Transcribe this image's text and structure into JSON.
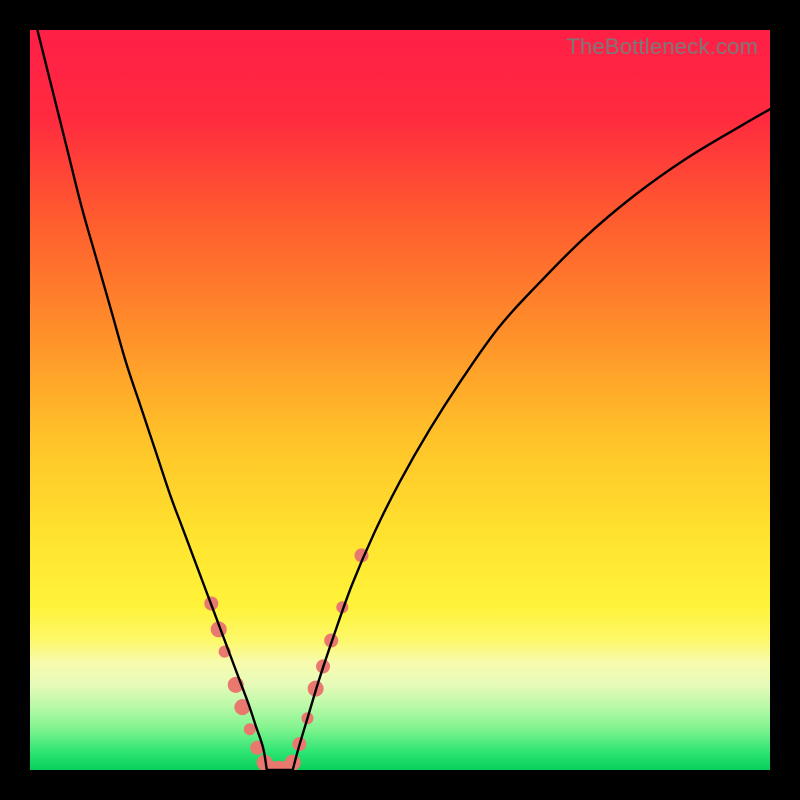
{
  "watermark": "TheBottleneck.com",
  "gradient": {
    "stops": [
      {
        "offset": 0.0,
        "color": "#ff1f46"
      },
      {
        "offset": 0.12,
        "color": "#ff2b3f"
      },
      {
        "offset": 0.25,
        "color": "#ff5a2f"
      },
      {
        "offset": 0.4,
        "color": "#ff8c2a"
      },
      {
        "offset": 0.55,
        "color": "#ffc229"
      },
      {
        "offset": 0.68,
        "color": "#ffe22e"
      },
      {
        "offset": 0.78,
        "color": "#fff33a"
      },
      {
        "offset": 0.825,
        "color": "#fdf86a"
      },
      {
        "offset": 0.855,
        "color": "#f8fbaf"
      },
      {
        "offset": 0.885,
        "color": "#e6fbb8"
      },
      {
        "offset": 0.915,
        "color": "#b7f9a6"
      },
      {
        "offset": 0.945,
        "color": "#7ef38e"
      },
      {
        "offset": 0.975,
        "color": "#2fe573"
      },
      {
        "offset": 1.0,
        "color": "#07cf5b"
      }
    ]
  },
  "chart_data": {
    "type": "line",
    "title": "",
    "xlabel": "",
    "ylabel": "",
    "xlim": [
      0,
      100
    ],
    "ylim": [
      0,
      100
    ],
    "grid": false,
    "legend": false,
    "series": [
      {
        "name": "left-branch",
        "x": [
          1,
          3,
          5,
          7,
          9,
          11,
          13,
          15,
          17,
          19,
          20.5,
          22,
          23.5,
          25,
          26.5,
          28,
          29.5,
          30.5,
          31.5,
          32
        ],
        "y": [
          100,
          92,
          84,
          76,
          69,
          62,
          55,
          49,
          43,
          37,
          33,
          29,
          25,
          21,
          17,
          13,
          9,
          6,
          3,
          0
        ]
      },
      {
        "name": "valley-floor",
        "x": [
          32,
          32.7,
          33.4,
          34.1,
          34.8,
          35.5
        ],
        "y": [
          0,
          0,
          0,
          0,
          0,
          0
        ]
      },
      {
        "name": "right-branch",
        "x": [
          35.5,
          36.3,
          37.5,
          39,
          41,
          43.5,
          46.5,
          50,
          54,
          58.5,
          63.5,
          69,
          75,
          81.5,
          88.5,
          96,
          100
        ],
        "y": [
          0,
          3,
          7,
          12,
          18,
          25,
          32,
          39,
          46,
          53,
          60,
          66,
          72,
          77.5,
          82.5,
          87,
          89.3
        ]
      }
    ],
    "markers": {
      "name": "highlight-dots",
      "color": "#e9786f",
      "points": [
        {
          "x": 24.5,
          "y": 22.5,
          "r": 7
        },
        {
          "x": 25.5,
          "y": 19.0,
          "r": 8
        },
        {
          "x": 26.3,
          "y": 16.0,
          "r": 6
        },
        {
          "x": 27.8,
          "y": 11.5,
          "r": 8
        },
        {
          "x": 28.7,
          "y": 8.5,
          "r": 8
        },
        {
          "x": 29.7,
          "y": 5.5,
          "r": 6
        },
        {
          "x": 30.7,
          "y": 3.0,
          "r": 7
        },
        {
          "x": 31.7,
          "y": 1.0,
          "r": 8
        },
        {
          "x": 32.6,
          "y": 0.3,
          "r": 7
        },
        {
          "x": 33.6,
          "y": 0.3,
          "r": 7
        },
        {
          "x": 34.6,
          "y": 0.3,
          "r": 7
        },
        {
          "x": 35.5,
          "y": 1.0,
          "r": 8
        },
        {
          "x": 36.4,
          "y": 3.5,
          "r": 7
        },
        {
          "x": 37.5,
          "y": 7.0,
          "r": 6
        },
        {
          "x": 38.6,
          "y": 11.0,
          "r": 8
        },
        {
          "x": 39.6,
          "y": 14.0,
          "r": 7
        },
        {
          "x": 40.7,
          "y": 17.5,
          "r": 7
        },
        {
          "x": 42.2,
          "y": 22.0,
          "r": 6
        },
        {
          "x": 44.8,
          "y": 29.0,
          "r": 7
        }
      ]
    }
  }
}
